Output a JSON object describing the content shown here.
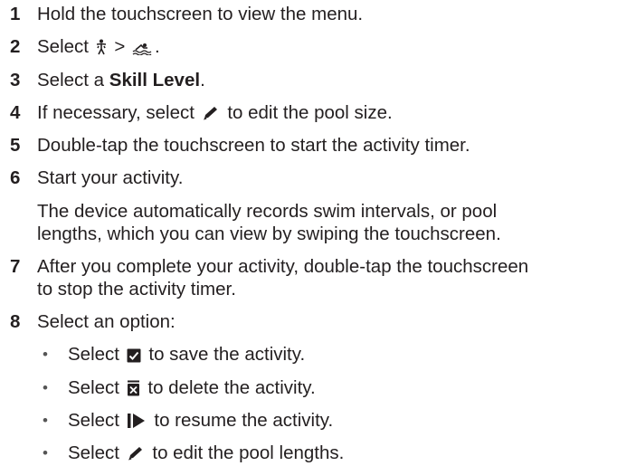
{
  "steps": [
    {
      "num": "1",
      "text": "Hold the touchscreen to view the menu."
    },
    {
      "num": "2",
      "pre": "Select",
      "sep": ">",
      "post": "."
    },
    {
      "num": "3",
      "pre": "Select a",
      "bold": "Skill Level",
      "post": "."
    },
    {
      "num": "4",
      "pre": "If necessary, select",
      "post": "to edit the pool size."
    },
    {
      "num": "5",
      "text": "Double-tap the touchscreen to start the activity timer."
    },
    {
      "num": "6",
      "text": "Start your activity."
    },
    {
      "line1": "The device automatically records swim intervals, or pool",
      "line2": "lengths, which you can view by swiping the touchscreen."
    },
    {
      "num": "7",
      "line1": "After you complete your activity, double-tap the touchscreen",
      "line2": "to stop the activity timer."
    },
    {
      "num": "8",
      "text": "Select an option:"
    }
  ],
  "options": [
    {
      "pre": "Select",
      "icon": "save-check-icon",
      "post": "to save the activity."
    },
    {
      "pre": "Select",
      "icon": "delete-x-icon",
      "post": "to delete the activity."
    },
    {
      "pre": "Select",
      "icon": "resume-play-icon",
      "post": "to resume the activity."
    },
    {
      "pre": "Select",
      "icon": "edit-pencil-icon",
      "post": "to edit the pool lengths."
    }
  ],
  "bullet": "•"
}
